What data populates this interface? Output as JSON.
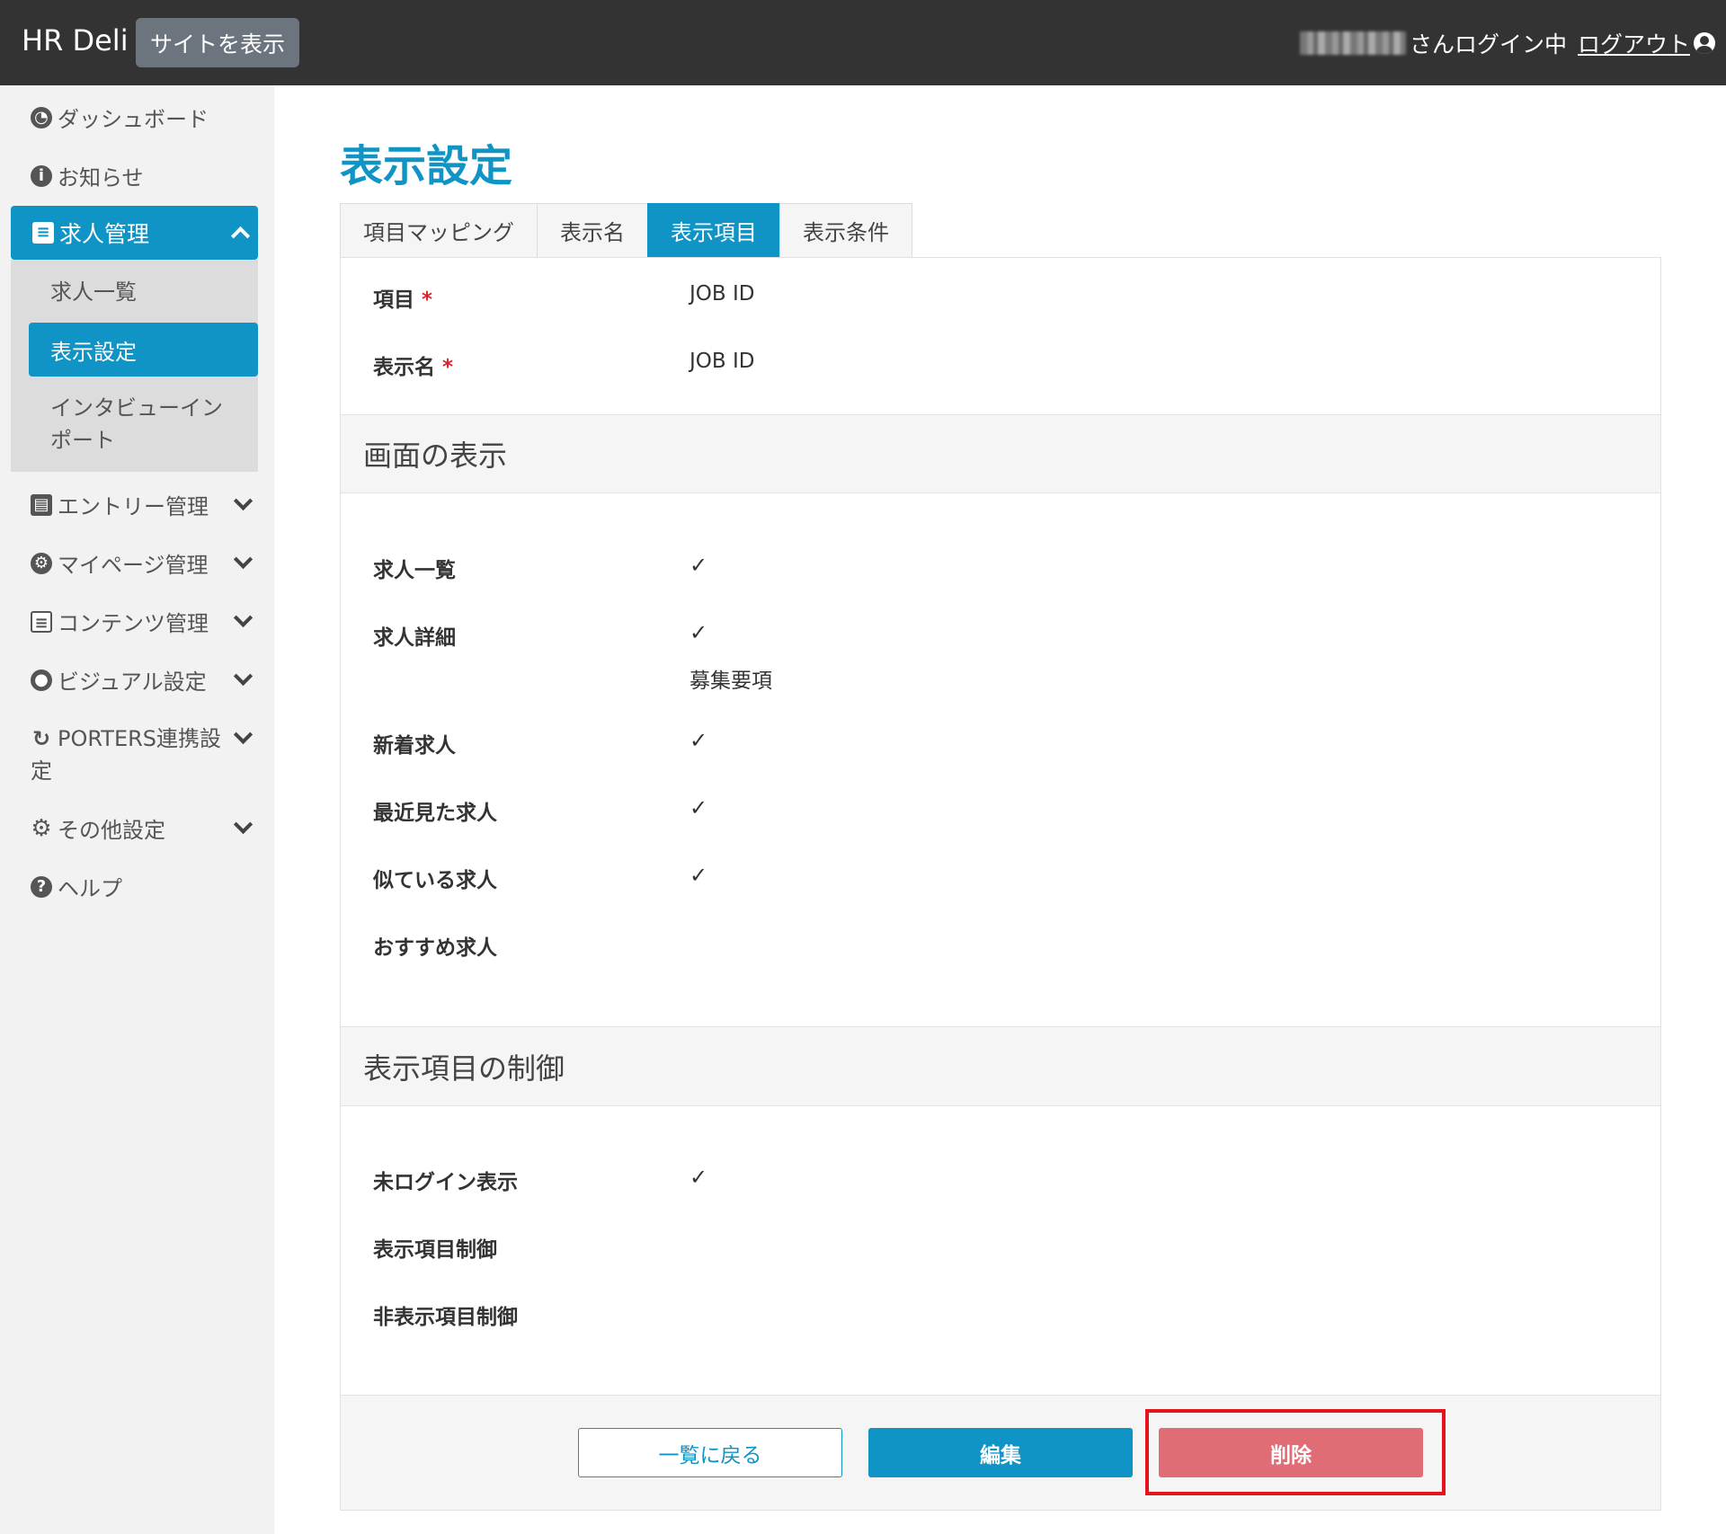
{
  "header": {
    "brand": "HR Deli",
    "site_button": "サイトを表示",
    "login_status": "さんログイン中",
    "logout": "ログアウト"
  },
  "sidebar": {
    "items": [
      {
        "label": "ダッシュボード",
        "icon": "dashboard-icon"
      },
      {
        "label": "お知らせ",
        "icon": "info-icon"
      },
      {
        "label": "求人管理",
        "icon": "card-icon",
        "expanded": true,
        "children": [
          "求人一覧",
          "表示設定",
          "インタビューイン",
          "ポート"
        ]
      },
      {
        "label": "エントリー管理",
        "icon": "id-card-icon"
      },
      {
        "label": "マイページ管理",
        "icon": "user-cog-icon"
      },
      {
        "label": "コンテンツ管理",
        "icon": "file-icon"
      },
      {
        "label": "ビジュアル設定",
        "icon": "palette-icon"
      },
      {
        "label": "PORTERS連携設",
        "label2": "定",
        "icon": "sync-icon"
      },
      {
        "label": "その他設定",
        "icon": "gear-icon"
      },
      {
        "label": "ヘルプ",
        "icon": "help-icon"
      }
    ]
  },
  "main": {
    "title": "表示設定",
    "tabs": [
      "項目マッピング",
      "表示名",
      "表示項目",
      "表示条件"
    ],
    "active_tab": "表示項目",
    "fields": [
      {
        "label": "項目",
        "required": "*",
        "value": "JOB ID"
      },
      {
        "label": "表示名",
        "required": "*",
        "value": "JOB ID"
      }
    ],
    "section1": {
      "title": "画面の表示",
      "rows": [
        {
          "label": "求人一覧",
          "value": "✓"
        },
        {
          "label": "求人詳細",
          "value": "✓",
          "sub": "募集要項"
        },
        {
          "label": "新着求人",
          "value": "✓"
        },
        {
          "label": "最近見た求人",
          "value": "✓"
        },
        {
          "label": "似ている求人",
          "value": "✓"
        },
        {
          "label": "おすすめ求人",
          "value": ""
        }
      ]
    },
    "section2": {
      "title": "表示項目の制御",
      "rows": [
        {
          "label": "未ログイン表示",
          "value": "✓"
        },
        {
          "label": "表示項目制御",
          "value": ""
        },
        {
          "label": "非表示項目制御",
          "value": ""
        }
      ]
    },
    "buttons": {
      "back": "一覧に戻る",
      "edit": "編集",
      "delete": "削除"
    }
  },
  "colors": {
    "header_bg": "#333333",
    "accent": "#1094c6",
    "delete": "#e06c76",
    "highlight": "#e5141c"
  }
}
